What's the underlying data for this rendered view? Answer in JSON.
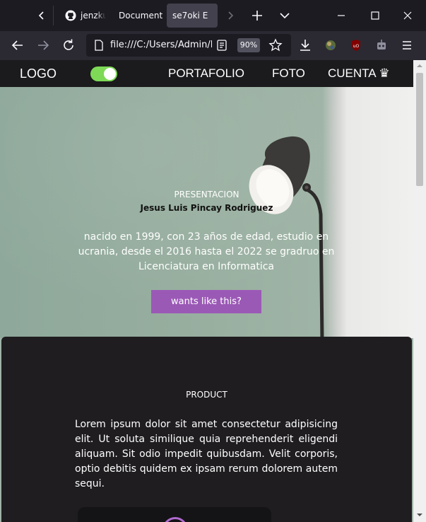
{
  "browser": {
    "tabs": [
      {
        "label": "jenzku",
        "icon": "github-icon",
        "active": false
      },
      {
        "label": "Document",
        "icon": "",
        "active": false
      },
      {
        "label": "se7oki E",
        "icon": "",
        "active": true
      }
    ],
    "url": "file:///C:/Users/Admin/D",
    "zoom": "90%"
  },
  "site": {
    "logo": "LOGO",
    "toggle_on": true,
    "nav": {
      "portfolio": "PORTAFOLIO",
      "photo": "FOTO",
      "account": "CUENTA ♛"
    }
  },
  "hero": {
    "title": "PRESENTACION",
    "name": "Jesus Luis Pincay Rodriguez",
    "description": "nacido en 1999, con 23 años de edad, estudio en ucrania, desde el 2016 hasta el 2022 se gradruo en Licenciatura en Informatica",
    "button": "wants like this?"
  },
  "product": {
    "title": "PRODUCT",
    "text": "Lorem ipsum dolor sit amet consectetur adipisicing elit. Ut soluta similique quia reprehenderit eligendi aliquam. Sit odio impedit quibusdam. Velit corporis, optio debitis quidem ex ipsam rerum dolorem autem sequi."
  },
  "colors": {
    "accent": "#9b59b6",
    "toggle": "#7ed957",
    "header": "#1b1a1c",
    "product_bg": "#1f1d20"
  }
}
